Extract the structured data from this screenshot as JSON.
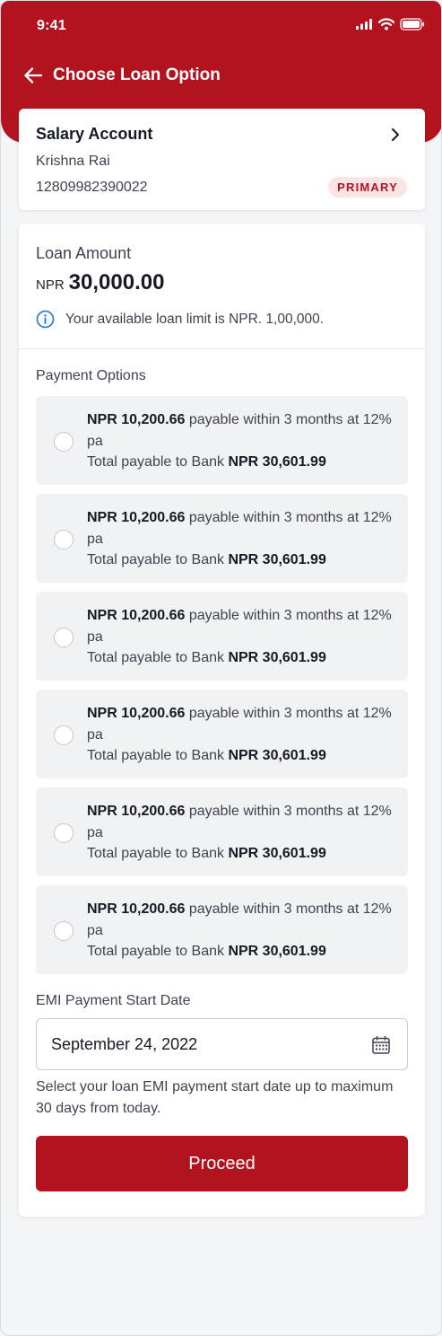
{
  "status_bar": {
    "time": "9:41"
  },
  "header": {
    "title": "Choose Loan Option"
  },
  "account": {
    "name": "Salary Account",
    "holder": "Krishna Rai",
    "number": "12809982390022",
    "badge": "PRIMARY"
  },
  "loan": {
    "label": "Loan Amount",
    "currency": "NPR",
    "amount": "30,000.00",
    "info": "Your available loan limit is NPR. 1,00,000."
  },
  "payment_options": {
    "label": "Payment Options",
    "items": [
      {
        "emi": "NPR 10,200.66",
        "terms": " payable within 3 months at 12% pa",
        "total_prefix": "Total payable to Bank ",
        "total": "NPR 30,601.99"
      },
      {
        "emi": "NPR 10,200.66",
        "terms": " payable within 3 months at 12% pa",
        "total_prefix": "Total payable to Bank ",
        "total": "NPR 30,601.99"
      },
      {
        "emi": "NPR 10,200.66",
        "terms": " payable within 3 months at 12% pa",
        "total_prefix": "Total payable to Bank ",
        "total": "NPR 30,601.99"
      },
      {
        "emi": "NPR 10,200.66",
        "terms": " payable within 3 months at 12% pa",
        "total_prefix": "Total payable to Bank ",
        "total": "NPR 30,601.99"
      },
      {
        "emi": "NPR 10,200.66",
        "terms": " payable within 3 months at 12% pa",
        "total_prefix": "Total payable to Bank ",
        "total": "NPR 30,601.99"
      },
      {
        "emi": "NPR 10,200.66",
        "terms": " payable within 3 months at 12% pa",
        "total_prefix": "Total payable to Bank ",
        "total": "NPR 30,601.99"
      }
    ]
  },
  "emi_start": {
    "label": "EMI Payment Start Date",
    "value": "September 24, 2022",
    "help": "Select your loan EMI payment start date up to maximum 30 days from today."
  },
  "actions": {
    "proceed_label": "Proceed"
  },
  "colors": {
    "brand": "#b3131f",
    "badge_bg": "#fbe4e6",
    "info": "#1a73d9"
  },
  "icons": [
    "signal-icon",
    "wifi-icon",
    "battery-icon",
    "back-arrow-icon",
    "chevron-right-icon",
    "info-icon",
    "calendar-icon"
  ]
}
